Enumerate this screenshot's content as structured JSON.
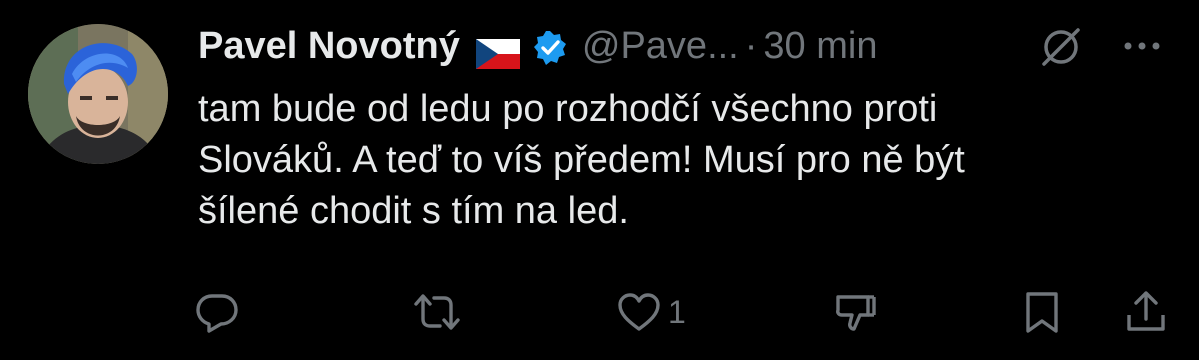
{
  "tweet": {
    "display_name": "Pavel Novotný",
    "flag": "czech-flag",
    "verified": "verified-badge-icon",
    "handle": "@Pave...",
    "separator": "·",
    "time": "30 min",
    "text": "tam bude od ledu po rozhodčí všechno proti\nSlováků. A teď to víš předem! Musí pro ně být\nšílené chodit s tím na led."
  },
  "actions": {
    "reply_icon": "reply-icon",
    "retweet_icon": "retweet-icon",
    "like_icon": "heart-icon",
    "like_count": "1",
    "dislike_icon": "thumbs-down-icon",
    "bookmark_icon": "bookmark-icon",
    "share_icon": "share-icon"
  },
  "colors": {
    "background": "#000000",
    "text": "#e7e9ea",
    "secondary": "#71767b",
    "verified": "#1d9bf0"
  }
}
